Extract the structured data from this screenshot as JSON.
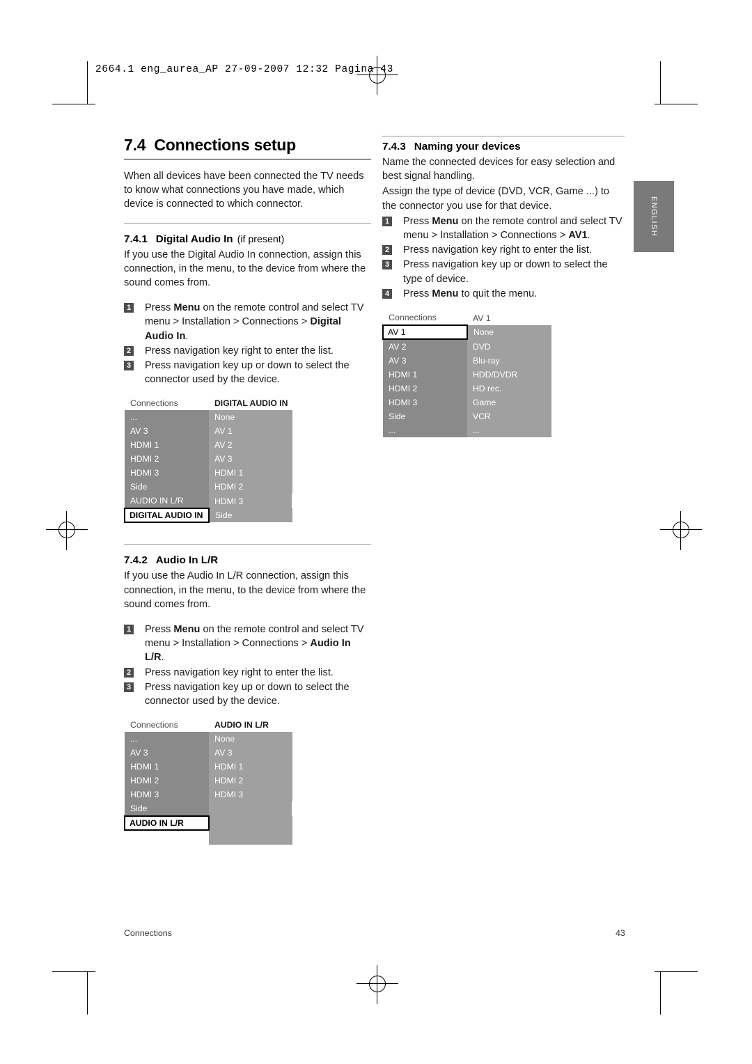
{
  "slug": "2664.1 eng_aurea_AP  27-09-2007  12:32  Pagina  43",
  "language_tab": "ENGLISH",
  "footer": {
    "left": "Connections",
    "right": "43"
  },
  "left_column": {
    "section": {
      "number": "7.4",
      "title": "Connections setup"
    },
    "intro": "When all devices have been connected the TV needs to know what connections you have made, which device is connected to which connector.",
    "sub1": {
      "number": "7.4.1",
      "title": "Digital Audio In",
      "note": "(if present)",
      "body": "If you use the Digital Audio In connection, assign this connection, in the menu, to the device from where the sound comes from.",
      "steps": [
        {
          "n": "1",
          "text_pre": "Press ",
          "bold1": "Menu",
          "text_mid": " on the remote control and select TV menu > Installation > Connections > ",
          "bold2": "Digital Audio In",
          "text_post": "."
        },
        {
          "n": "2",
          "text_pre": "Press navigation key right to enter the list.",
          "bold1": "",
          "text_mid": "",
          "bold2": "",
          "text_post": ""
        },
        {
          "n": "3",
          "text_pre": "Press navigation key up or down to select the connector used by the device.",
          "bold1": "",
          "text_mid": "",
          "bold2": "",
          "text_post": ""
        }
      ],
      "menu": {
        "header_left": "Connections",
        "header_right": "DIGITAL AUDIO IN",
        "rows": [
          {
            "left": "...",
            "right": "None",
            "left_state": "dark",
            "right_state": "light"
          },
          {
            "left": "AV 3",
            "right": "AV 1",
            "left_state": "dark",
            "right_state": "light"
          },
          {
            "left": "HDMI 1",
            "right": "AV 2",
            "left_state": "dark",
            "right_state": "light"
          },
          {
            "left": "HDMI 2",
            "right": "AV 3",
            "left_state": "dark",
            "right_state": "light"
          },
          {
            "left": "HDMI 3",
            "right": "HDMI 1",
            "left_state": "dark",
            "right_state": "light"
          },
          {
            "left": "Side",
            "right": "HDMI 2",
            "left_state": "dark",
            "right_state": "light"
          },
          {
            "left": "AUDIO IN L/R",
            "right": "HDMI 3",
            "left_state": "dark",
            "right_state": "light"
          },
          {
            "left": "DIGITAL AUDIO IN",
            "right": "Side",
            "left_state": "selected",
            "right_state": "light"
          }
        ]
      }
    },
    "sub2": {
      "number": "7.4.2",
      "title": "Audio In L/R",
      "body": "If you use the Audio In L/R connection, assign this connection, in the menu, to the device from where the sound comes from.",
      "steps": [
        {
          "n": "1",
          "text_pre": "Press ",
          "bold1": "Menu",
          "text_mid": " on the remote control and select TV menu > Installation > Connections > ",
          "bold2": "Audio In L/R",
          "text_post": "."
        },
        {
          "n": "2",
          "text_pre": "Press navigation key right to enter the list.",
          "bold1": "",
          "text_mid": "",
          "bold2": "",
          "text_post": ""
        },
        {
          "n": "3",
          "text_pre": "Press navigation key up or down to select the connector used by the device.",
          "bold1": "",
          "text_mid": "",
          "bold2": "",
          "text_post": ""
        }
      ],
      "menu": {
        "header_left": "Connections",
        "header_right": "AUDIO IN L/R",
        "rows": [
          {
            "left": "...",
            "right": "None",
            "left_state": "dark",
            "right_state": "light"
          },
          {
            "left": "AV 3",
            "right": "AV 3",
            "left_state": "dark",
            "right_state": "light"
          },
          {
            "left": "HDMI 1",
            "right": "HDMI 1",
            "left_state": "dark",
            "right_state": "light"
          },
          {
            "left": "HDMI 2",
            "right": "HDMI 2",
            "left_state": "dark",
            "right_state": "light"
          },
          {
            "left": "HDMI 3",
            "right": "HDMI 3",
            "left_state": "dark",
            "right_state": "light"
          },
          {
            "left": "Side",
            "right": "",
            "left_state": "dark",
            "right_state": "light"
          },
          {
            "left": "AUDIO IN L/R",
            "right": "",
            "left_state": "selected",
            "right_state": "light"
          },
          {
            "left": "",
            "right": "",
            "left_state": "blank",
            "right_state": "light"
          }
        ]
      }
    }
  },
  "right_column": {
    "sub3": {
      "number": "7.4.3",
      "title": "Naming your devices",
      "body1": "Name the connected devices for easy selection and best signal handling.",
      "body2": "Assign the type of device (DVD, VCR, Game ...) to the connector you use for that device.",
      "steps": [
        {
          "n": "1",
          "text_pre": "Press ",
          "bold1": "Menu",
          "text_mid": " on the remote control and select TV menu > Installation > Connections > ",
          "bold2": "AV1",
          "text_post": "."
        },
        {
          "n": "2",
          "text_pre": "Press navigation key right to enter the list.",
          "bold1": "",
          "text_mid": "",
          "bold2": "",
          "text_post": ""
        },
        {
          "n": "3",
          "text_pre": "Press navigation key up or down to select the type of device.",
          "bold1": "",
          "text_mid": "",
          "bold2": "",
          "text_post": ""
        },
        {
          "n": "4",
          "text_pre": "Press ",
          "bold1": "Menu",
          "text_mid": " to quit the menu.",
          "bold2": "",
          "text_post": ""
        }
      ],
      "menu": {
        "header_left": "Connections",
        "header_right": "AV 1",
        "rows": [
          {
            "left": "AV 1",
            "right": "None",
            "left_state": "selected2",
            "right_state": "light"
          },
          {
            "left": "AV 2",
            "right": "DVD",
            "left_state": "dark",
            "right_state": "light"
          },
          {
            "left": "AV 3",
            "right": "Blu-ray",
            "left_state": "dark",
            "right_state": "light"
          },
          {
            "left": "HDMI 1",
            "right": "HDD/DVDR",
            "left_state": "dark",
            "right_state": "light"
          },
          {
            "left": "HDMI 2",
            "right": "HD rec.",
            "left_state": "dark",
            "right_state": "light"
          },
          {
            "left": "HDMI 3",
            "right": "Game",
            "left_state": "dark",
            "right_state": "light"
          },
          {
            "left": "Side",
            "right": "VCR",
            "left_state": "dark",
            "right_state": "light"
          },
          {
            "left": "...",
            "right": "...",
            "left_state": "dark",
            "right_state": "light"
          }
        ]
      }
    }
  }
}
